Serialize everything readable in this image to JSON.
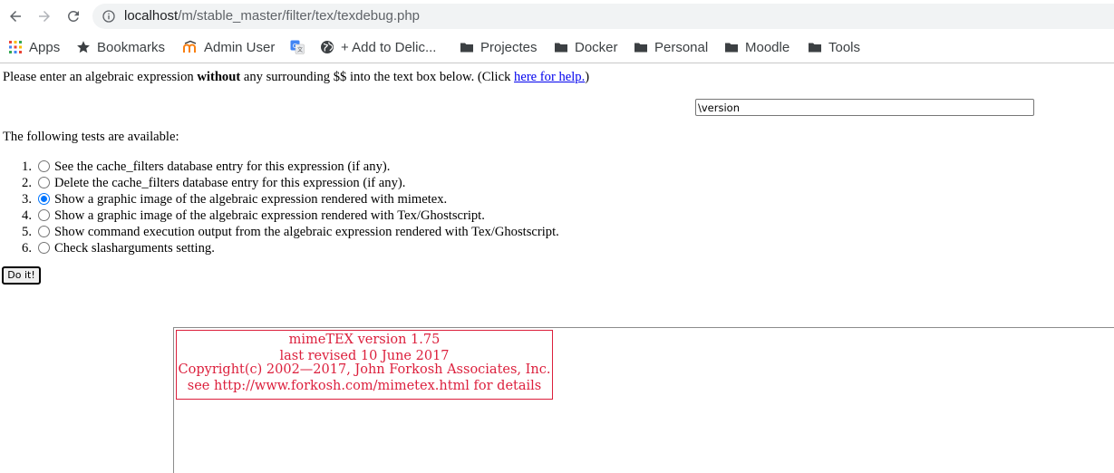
{
  "browser": {
    "url_host": "localhost",
    "url_path": "/m/stable_master/filter/tex/texdebug.php",
    "bookmarks": [
      {
        "label": "Apps",
        "icon": "apps-grid-icon"
      },
      {
        "label": "Bookmarks",
        "icon": "star-icon"
      },
      {
        "label": "Admin User",
        "icon": "moodle-icon"
      },
      {
        "label": "",
        "icon": "google-translate-icon"
      },
      {
        "label": "+ Add to Delic...",
        "icon": "globe-icon"
      },
      {
        "label": "Projectes",
        "icon": "folder-icon"
      },
      {
        "label": "Docker",
        "icon": "folder-icon"
      },
      {
        "label": "Personal",
        "icon": "folder-icon"
      },
      {
        "label": "Moodle",
        "icon": "folder-icon"
      },
      {
        "label": "Tools",
        "icon": "folder-icon"
      }
    ]
  },
  "page": {
    "intro_before": "Please enter an algebraic expression ",
    "intro_bold": "without",
    "intro_after": " any surrounding $$ into the text box below. (Click ",
    "help_link": "here for help.",
    "intro_end": ")",
    "expression_value": "\\version",
    "tests_heading": "The following tests are available:",
    "tests": [
      {
        "num": "1.",
        "label": "See the cache_filters database entry for this expression (if any).",
        "checked": false
      },
      {
        "num": "2.",
        "label": "Delete the cache_filters database entry for this expression (if any).",
        "checked": false
      },
      {
        "num": "3.",
        "label": "Show a graphic image of the algebraic expression rendered with mimetex.",
        "checked": true
      },
      {
        "num": "4.",
        "label": "Show a graphic image of the algebraic expression rendered with Tex/Ghostscript.",
        "checked": false
      },
      {
        "num": "5.",
        "label": "Show command execution output from the algebraic expression rendered with Tex/Ghostscript.",
        "checked": false
      },
      {
        "num": "6.",
        "label": "Check slasharguments setting.",
        "checked": false
      }
    ],
    "submit_label": "Do it!"
  },
  "output": {
    "lines": [
      "mimeTEX version 1.75",
      "last revised 10 June 2017",
      "Copyright(c) 2002—2017, John Forkosh Associates, Inc.",
      "see http://www.forkosh.com/mimetex.html for details"
    ],
    "color": "#dc1f3c"
  }
}
